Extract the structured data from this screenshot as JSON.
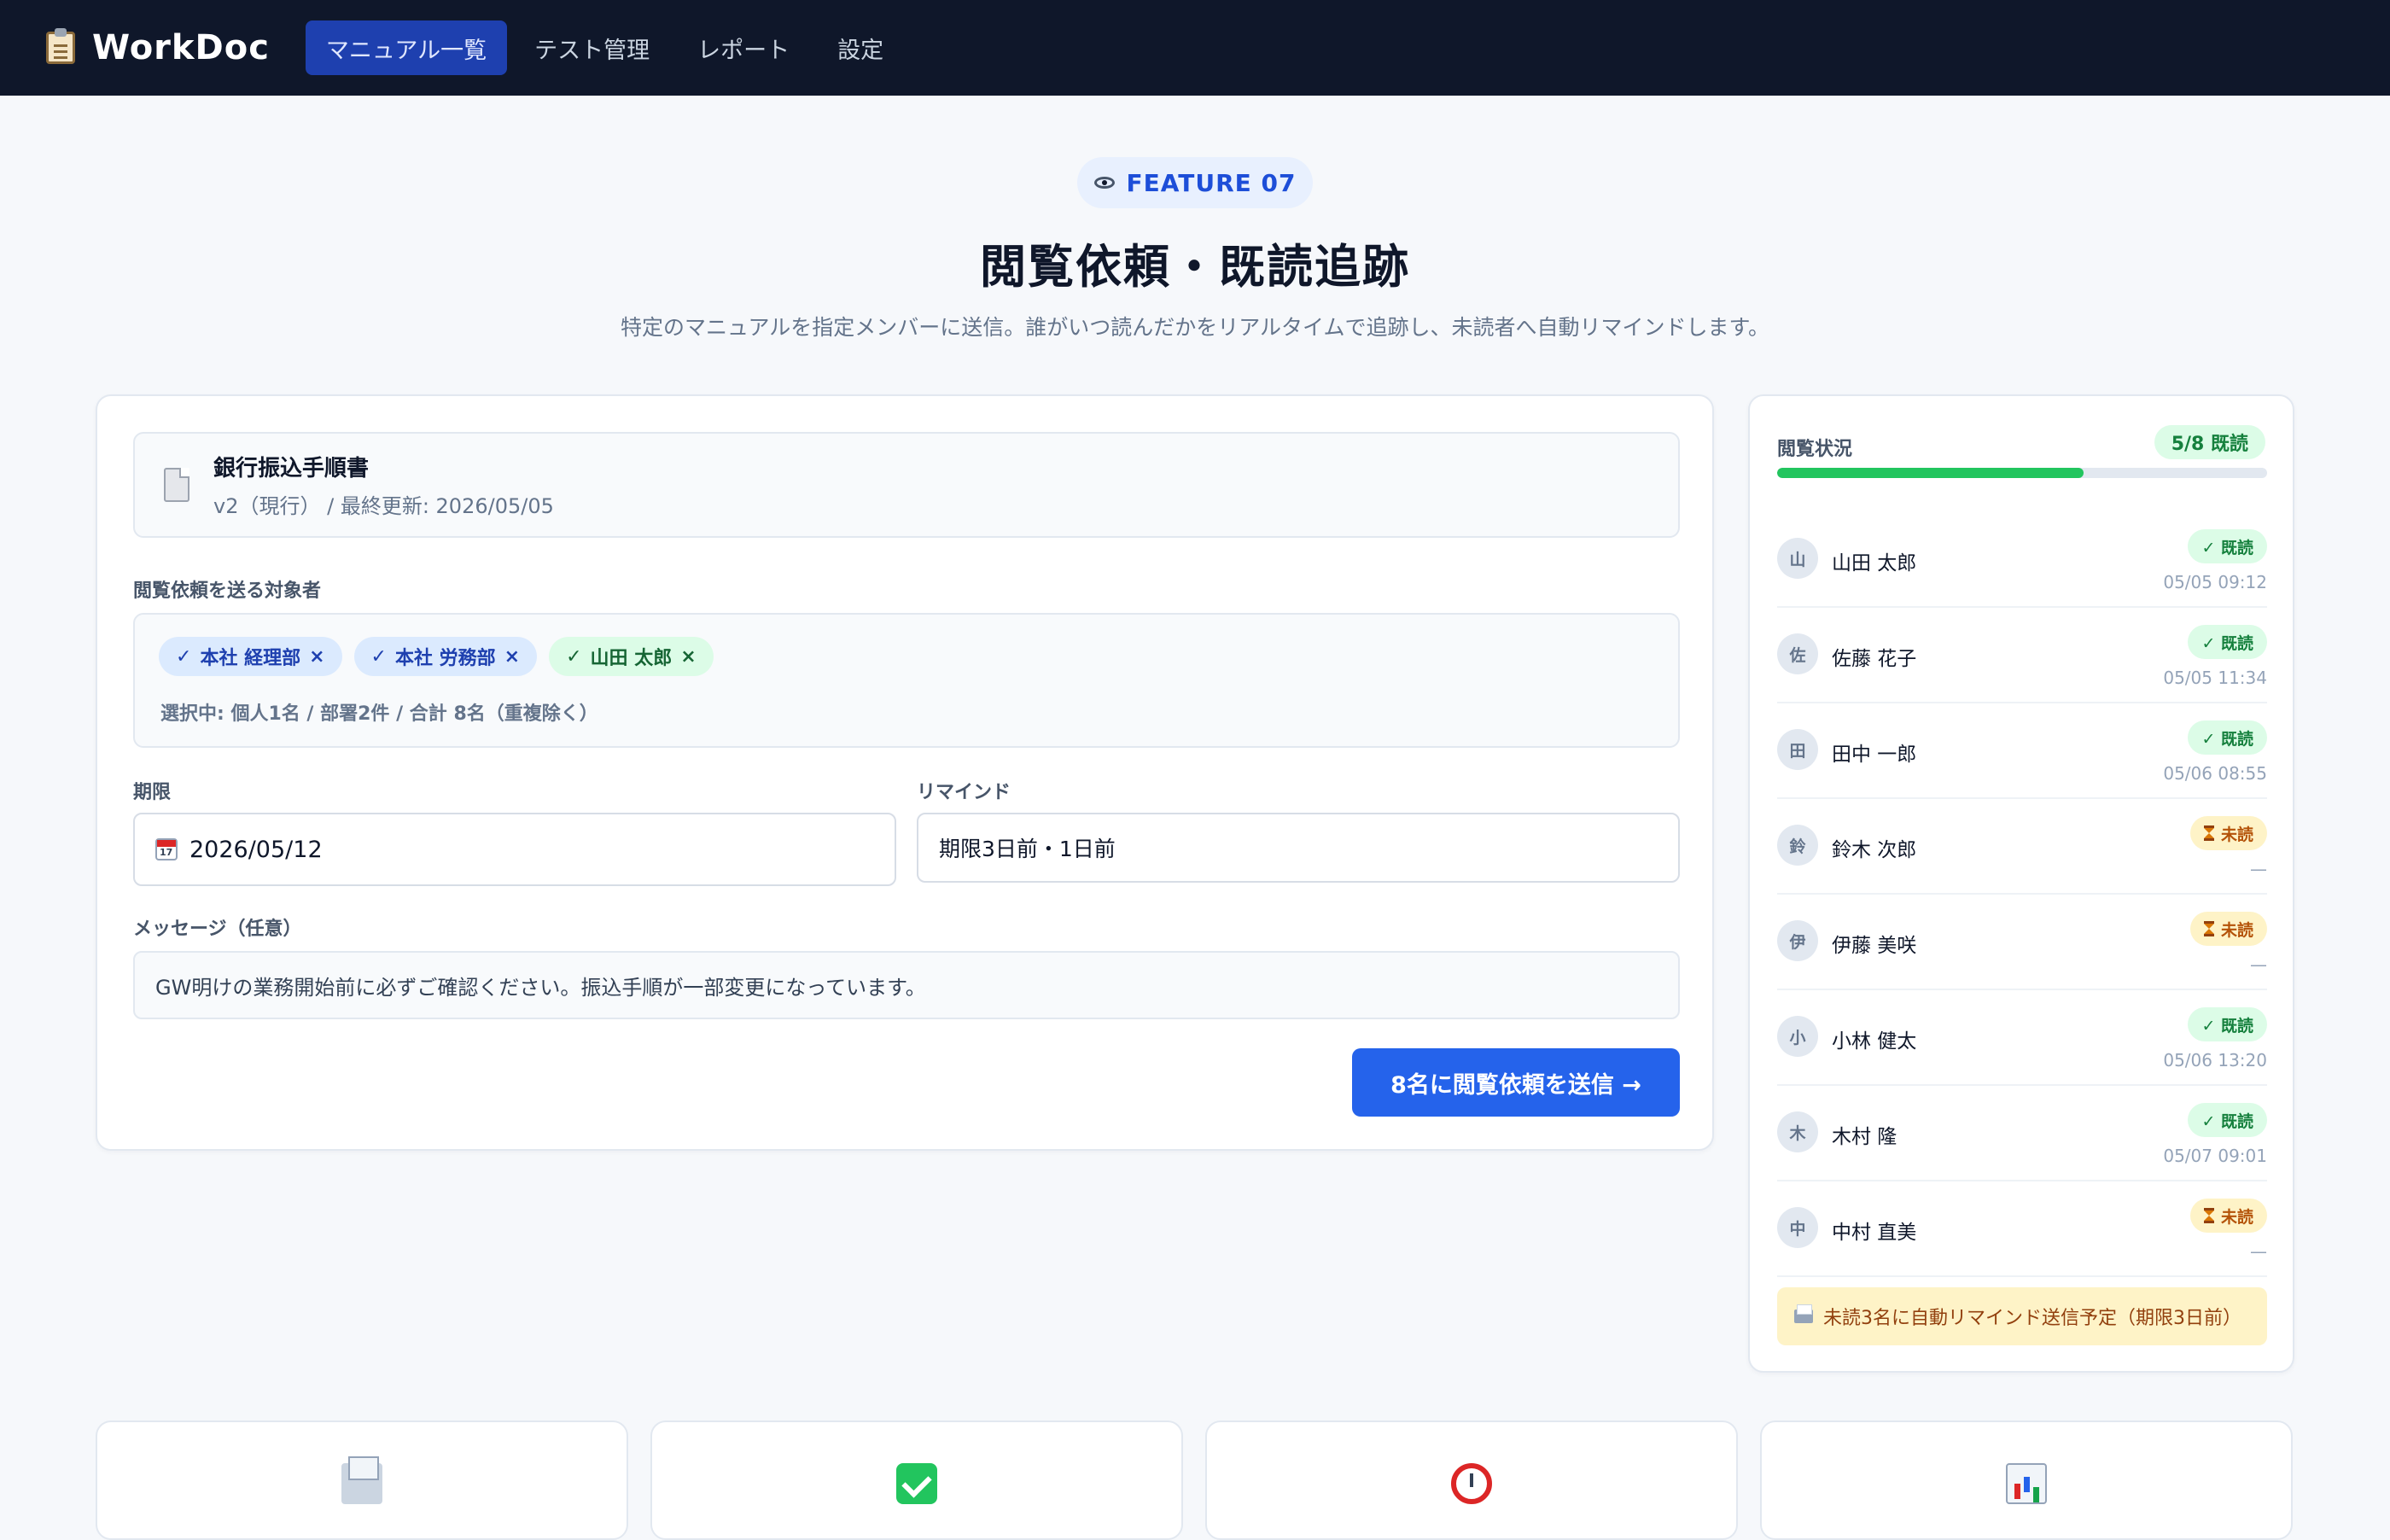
{
  "app": {
    "name": "WorkDoc"
  },
  "nav": [
    {
      "label": "マニュアル一覧",
      "active": true
    },
    {
      "label": "テスト管理",
      "active": false
    },
    {
      "label": "レポート",
      "active": false
    },
    {
      "label": "設定",
      "active": false
    }
  ],
  "hero": {
    "pill": "FEATURE 07",
    "title": "閲覧依頼・既読追跡",
    "subtitle": "特定のマニュアルを指定メンバーに送信。誰がいつ読んだかをリアルタイムで追跡し、未読者へ自動リマインドします。"
  },
  "form": {
    "doc": {
      "name": "銀行振込手順書",
      "meta": "v2（現行） / 最終更新: 2026/05/05"
    },
    "target_label": "閲覧依頼を送る対象者",
    "chips": [
      {
        "check": "✓",
        "label": "本社 経理部",
        "remove": "×",
        "kind": "dept"
      },
      {
        "check": "✓",
        "label": "本社 労務部",
        "remove": "×",
        "kind": "dept"
      },
      {
        "check": "✓",
        "label": "山田 太郎",
        "remove": "×",
        "kind": "person"
      }
    ],
    "selection_summary": "選択中: 個人1名 / 部署2件 / 合計 8名（重複除く）",
    "deadline_label": "期限",
    "deadline_value": "2026/05/12",
    "remind_label": "リマインド",
    "remind_value": "期限3日前・1日前",
    "message_label": "メッセージ（任意）",
    "message_value": "GW明けの業務開始前に必ずご確認ください。振込手順が一部変更になっています。",
    "send_button": "8名に閲覧依頼を送信 →"
  },
  "status": {
    "title": "閲覧状況",
    "count_badge": "5/8 既読",
    "progress": 0.625,
    "readers": [
      {
        "initial": "山",
        "name": "山田 太郎",
        "state": "read",
        "badge": "✓ 既読",
        "time": "05/05 09:12"
      },
      {
        "initial": "佐",
        "name": "佐藤 花子",
        "state": "read",
        "badge": "✓ 既読",
        "time": "05/05 11:34"
      },
      {
        "initial": "田",
        "name": "田中 一郎",
        "state": "read",
        "badge": "✓ 既読",
        "time": "05/06 08:55"
      },
      {
        "initial": "鈴",
        "name": "鈴木 次郎",
        "state": "unread",
        "badge": "未読",
        "time": "—"
      },
      {
        "initial": "伊",
        "name": "伊藤 美咲",
        "state": "unread",
        "badge": "未読",
        "time": "—"
      },
      {
        "initial": "小",
        "name": "小林 健太",
        "state": "read",
        "badge": "✓ 既読",
        "time": "05/06 13:20"
      },
      {
        "initial": "木",
        "name": "木村 隆",
        "state": "read",
        "badge": "✓ 既読",
        "time": "05/07 09:01"
      },
      {
        "initial": "中",
        "name": "中村 直美",
        "state": "unread",
        "badge": "未読",
        "time": "—"
      }
    ],
    "remind_note": "未読3名に自動リマインド送信予定（期限3日前）"
  },
  "feature_cards": [
    {
      "icon": "envelope-icon"
    },
    {
      "icon": "check-icon"
    },
    {
      "icon": "alarm-clock-icon"
    },
    {
      "icon": "bar-chart-icon"
    }
  ],
  "colors": {
    "nav_bg": "#0f172a",
    "accent": "#2563eb",
    "read": "#15803d",
    "unread": "#b45309"
  }
}
